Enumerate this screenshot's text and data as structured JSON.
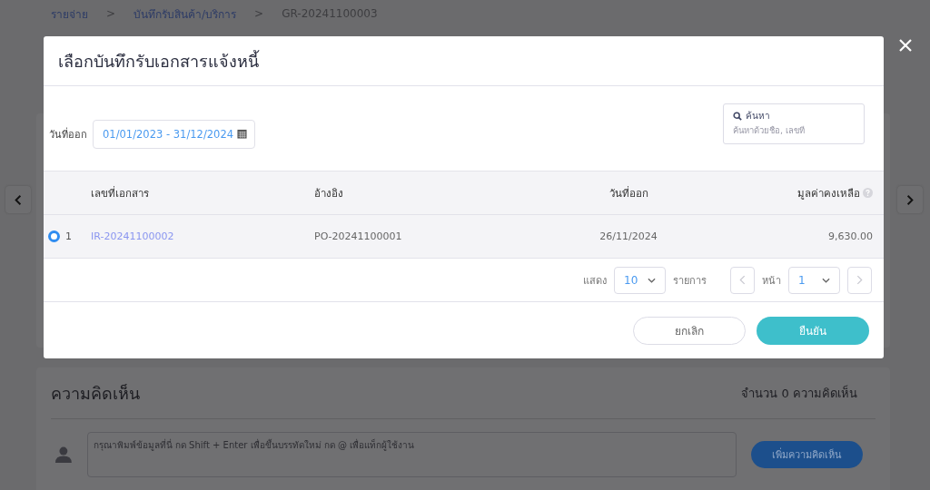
{
  "breadcrumb": [
    "รายจ่าย",
    "บันทึกรับสินค้า/บริการ",
    "GR-20241100003"
  ],
  "breadcrumb_separator": ">",
  "modal": {
    "title": "เลือกบันทึกรับเอกสารแจ้งหนี้",
    "date_filter": {
      "label": "วันที่ออก",
      "value": "01/01/2023 - 31/12/2024"
    },
    "search": {
      "label": "ค้นหา",
      "placeholder": "ค้นหาด้วยชื่อ, เลขที่"
    },
    "table": {
      "columns": [
        "เลขที่เอกสาร",
        "อ้างอิง",
        "วันที่ออก",
        "มูลค่าคงเหลือ"
      ],
      "rows": [
        {
          "selected": true,
          "index": "1",
          "doc_no": "IR-20241100002",
          "reference": "PO-20241100001",
          "date": "26/11/2024",
          "balance": "9,630.00"
        }
      ]
    },
    "pagination": {
      "show_label": "แสดง",
      "page_size": "10",
      "items_label": "รายการ",
      "page_label": "หน้า",
      "page": "1"
    },
    "buttons": {
      "cancel": "ยกเลิก",
      "confirm": "ยืนยัน"
    }
  },
  "comments": {
    "title": "ความคิดเห็น",
    "count": "จำนวน 0 ความคิดเห็น",
    "placeholder": "กรุณาพิมพ์ข้อมูลที่นี่ กด Shift + Enter เพื่อขึ้นบรรทัดใหม่ กด @ เพื่อแท็กผู้ใช้งาน",
    "add_button": "เพิ่มความคิดเห็น"
  }
}
